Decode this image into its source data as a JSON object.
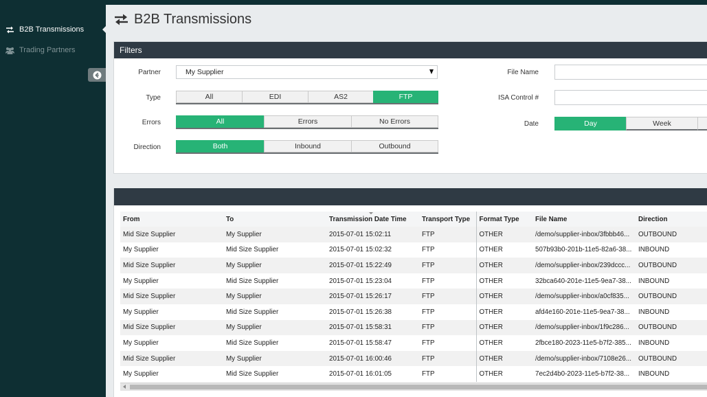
{
  "sidebar": {
    "items": [
      {
        "label": "B2B Transmissions",
        "icon": "exchange-icon",
        "active": true
      },
      {
        "label": "Trading Partners",
        "icon": "users-icon",
        "active": false
      }
    ]
  },
  "page": {
    "title": "B2B Transmissions"
  },
  "filters": {
    "heading": "Filters",
    "partner": {
      "label": "Partner",
      "value": "My Supplier"
    },
    "type": {
      "label": "Type",
      "options": [
        "All",
        "EDI",
        "AS2",
        "FTP"
      ],
      "selected": "FTP"
    },
    "errors": {
      "label": "Errors",
      "options": [
        "All",
        "Errors",
        "No Errors"
      ],
      "selected": "All"
    },
    "direction": {
      "label": "Direction",
      "options": [
        "Both",
        "Inbound",
        "Outbound"
      ],
      "selected": "Both"
    },
    "file_name": {
      "label": "File Name",
      "value": ""
    },
    "isa_control": {
      "label": "ISA Control #",
      "value": ""
    },
    "date": {
      "label": "Date",
      "options": [
        "Day",
        "Week"
      ],
      "selected": "Day"
    }
  },
  "grid": {
    "columns": [
      "From",
      "To",
      "Transmission Date Time",
      "Transport Type",
      "Format Type",
      "File Name",
      "Direction"
    ],
    "rows": [
      [
        "Mid Size Supplier",
        "My Supplier",
        "2015-07-01 15:02:11",
        "FTP",
        "OTHER",
        "/demo/supplier-inbox/3fbbb46...",
        "OUTBOUND"
      ],
      [
        "My Supplier",
        "Mid Size Supplier",
        "2015-07-01 15:02:32",
        "FTP",
        "OTHER",
        "507b93b0-201b-11e5-82a6-38...",
        "INBOUND"
      ],
      [
        "Mid Size Supplier",
        "My Supplier",
        "2015-07-01 15:22:49",
        "FTP",
        "OTHER",
        "/demo/supplier-inbox/239dccc...",
        "OUTBOUND"
      ],
      [
        "My Supplier",
        "Mid Size Supplier",
        "2015-07-01 15:23:04",
        "FTP",
        "OTHER",
        "32bca640-201e-11e5-9ea7-38...",
        "INBOUND"
      ],
      [
        "Mid Size Supplier",
        "My Supplier",
        "2015-07-01 15:26:17",
        "FTP",
        "OTHER",
        "/demo/supplier-inbox/a0cf835...",
        "OUTBOUND"
      ],
      [
        "My Supplier",
        "Mid Size Supplier",
        "2015-07-01 15:26:38",
        "FTP",
        "OTHER",
        "afd4e160-201e-11e5-9ea7-38...",
        "INBOUND"
      ],
      [
        "Mid Size Supplier",
        "My Supplier",
        "2015-07-01 15:58:31",
        "FTP",
        "OTHER",
        "/demo/supplier-inbox/1f9c286...",
        "OUTBOUND"
      ],
      [
        "My Supplier",
        "Mid Size Supplier",
        "2015-07-01 15:58:47",
        "FTP",
        "OTHER",
        "2fbce180-2023-11e5-b7f2-385...",
        "INBOUND"
      ],
      [
        "Mid Size Supplier",
        "My Supplier",
        "2015-07-01 16:00:46",
        "FTP",
        "OTHER",
        "/demo/supplier-inbox/7108e26...",
        "OUTBOUND"
      ],
      [
        "My Supplier",
        "Mid Size Supplier",
        "2015-07-01 16:01:05",
        "FTP",
        "OTHER",
        "7ec2d4b0-2023-11e5-b7f2-38...",
        "INBOUND"
      ]
    ]
  },
  "colors": {
    "accent": "#27b376",
    "sidebar": "#0e2f33",
    "panel_header": "#2f3a44"
  }
}
